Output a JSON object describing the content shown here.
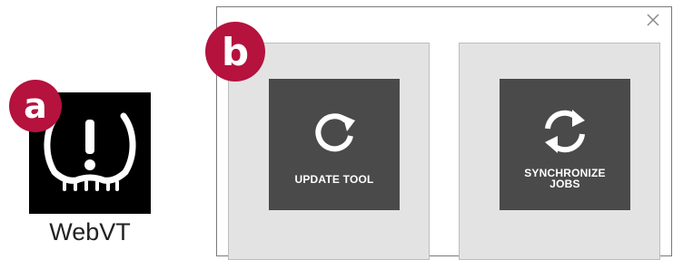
{
  "badges": {
    "a": "a",
    "b": "b"
  },
  "app": {
    "name": "WebVT",
    "icon": "tire-pressure-warning-icon"
  },
  "dialog": {
    "close": "×",
    "tiles": [
      {
        "label": "UPDATE TOOL",
        "icon": "rotate-arrow-icon"
      },
      {
        "label_line1": "SYNCHRONIZE",
        "label_line2": "JOBS",
        "icon": "sync-arrows-icon"
      }
    ]
  },
  "colors": {
    "badge": "#b5123e",
    "tile_background": "#e3e3e3",
    "tile_inner": "#4a4a4a",
    "app_icon_background": "#000000"
  }
}
